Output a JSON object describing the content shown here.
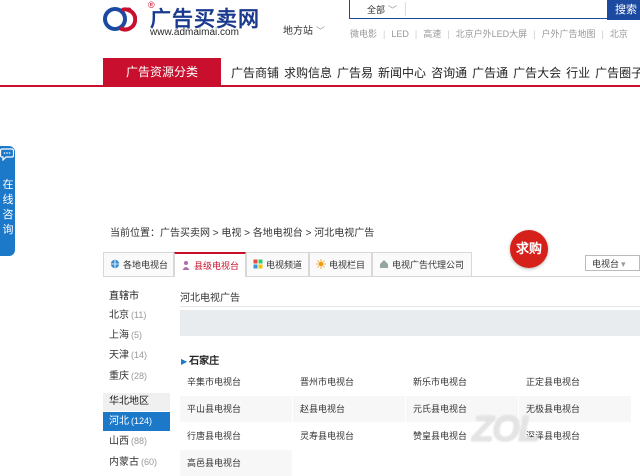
{
  "brand": {
    "name": "广告买卖网",
    "url": "www.admaimai.com",
    "reg": "®"
  },
  "header": {
    "region": "地方站",
    "search_category": "全部",
    "search_button": "搜索"
  },
  "hot_links": [
    "微电影",
    "LED",
    "高速",
    "北京户外LED大屏",
    "户外广告地图",
    "北京"
  ],
  "nav": {
    "active": "广告资源分类",
    "items": [
      "广告商铺",
      "求购信息",
      "广告易",
      "新闻中心",
      "咨询通",
      "广告通",
      "广告大会",
      "行业",
      "广告圈子"
    ]
  },
  "float_contact": {
    "text": "在线咨询"
  },
  "breadcrumb": "当前位置：广告买卖网 > 电视 > 各地电视台 > 河北电视广告",
  "tabs": [
    "各地电视台",
    "县级电视台",
    "电视频道",
    "电视栏目",
    "电视广告代理公司"
  ],
  "qiugou": "求购",
  "select": {
    "value": "电视台"
  },
  "sidebar": {
    "group1": "直辖市",
    "items1": [
      {
        "name": "北京",
        "count": "(11)"
      },
      {
        "name": "上海",
        "count": "(5)"
      },
      {
        "name": "天津",
        "count": "(14)"
      },
      {
        "name": "重庆",
        "count": "(28)"
      }
    ],
    "group2": "华北地区",
    "items2": [
      {
        "name": "河北",
        "count": "(124)"
      },
      {
        "name": "山西",
        "count": "(88)"
      },
      {
        "name": "内蒙古",
        "count": "(60)"
      }
    ]
  },
  "main": {
    "title": "河北电视广告",
    "city": "石家庄",
    "stations": [
      "辛集市电视台",
      "晋州市电视台",
      "新乐市电视台",
      "正定县电视台",
      "平山县电视台",
      "赵县电视台",
      "元氏县电视台",
      "无极县电视台",
      "行唐县电视台",
      "灵寿县电视台",
      "赞皇县电视台",
      "深泽县电视台",
      "高邑县电视台"
    ]
  },
  "watermark": "ZOL",
  "colors": {
    "brand_red": "#c8102e",
    "brand_blue": "#1b4aa0",
    "side_blue": "#1c78c9"
  }
}
